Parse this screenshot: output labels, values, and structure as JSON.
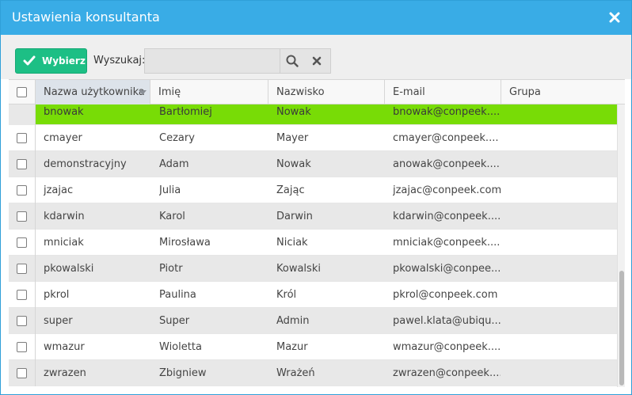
{
  "dialog": {
    "title": "Ustawienia konsultanta",
    "close_icon": "close-icon"
  },
  "toolbar": {
    "select_label": "Wybierz",
    "search_label": "Wyszukaj:",
    "search_value": "",
    "search_placeholder": "",
    "colors": {
      "select_button": "#1dbf85",
      "titlebar": "#39ace6"
    }
  },
  "grid": {
    "columns": [
      "Nazwa użytkownika",
      "Imię",
      "Nazwisko",
      "E-mail",
      "Grupa"
    ],
    "sorted_column": "Nazwa użytkownika",
    "scroll_position": 0.6,
    "rows": [
      {
        "username": "bnowak",
        "first": "Bartłomiej",
        "last": "Nowak",
        "email": "bnowak@conpeek....",
        "group": "",
        "selected": true
      },
      {
        "username": "cmayer",
        "first": "Cezary",
        "last": "Mayer",
        "email": "cmayer@conpeek....",
        "group": "",
        "selected": false
      },
      {
        "username": "demonstracyjny",
        "first": "Adam",
        "last": "Nowak",
        "email": "anowak@conpeek....",
        "group": "",
        "selected": false
      },
      {
        "username": "jzajac",
        "first": "Julia",
        "last": "Zając",
        "email": "jzajac@conpeek.com",
        "group": "",
        "selected": false
      },
      {
        "username": "kdarwin",
        "first": "Karol",
        "last": "Darwin",
        "email": "kdarwin@conpeek....",
        "group": "",
        "selected": false
      },
      {
        "username": "mniciak",
        "first": "Mirosława",
        "last": "Niciak",
        "email": "mniciak@conpeek....",
        "group": "",
        "selected": false
      },
      {
        "username": "pkowalski",
        "first": "Piotr",
        "last": "Kowalski",
        "email": "pkowalski@conpee...",
        "group": "",
        "selected": false
      },
      {
        "username": "pkrol",
        "first": "Paulina",
        "last": "Król",
        "email": "pkrol@conpeek.com",
        "group": "",
        "selected": false
      },
      {
        "username": "super",
        "first": "Super",
        "last": "Admin",
        "email": "pawel.klata@ubiqu...",
        "group": "",
        "selected": false
      },
      {
        "username": "wmazur",
        "first": "Wioletta",
        "last": "Mazur",
        "email": "wmazur@conpeek....",
        "group": "",
        "selected": false
      },
      {
        "username": "zwrazen",
        "first": "Zbigniew",
        "last": "Wrażeń",
        "email": "zwrazen@conpeek....",
        "group": "",
        "selected": false
      }
    ]
  }
}
